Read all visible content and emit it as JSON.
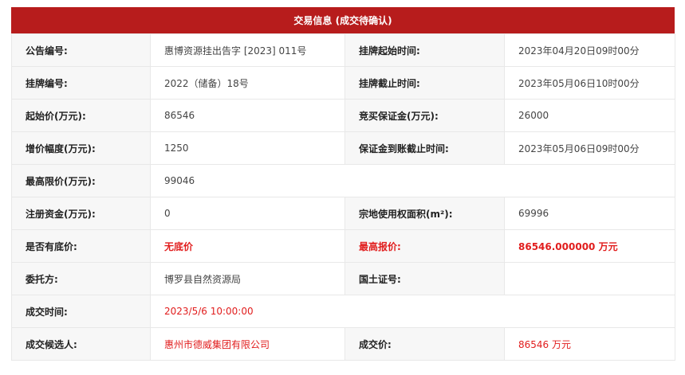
{
  "panel_title": "交易信息 (成交待确认)",
  "rows": [
    {
      "l1": "公告编号:",
      "v1": "惠博资源挂出告字 [2023] 011号",
      "l2": "挂牌起始时间:",
      "v2": "2023年04月20日09时00分"
    },
    {
      "l1": "挂牌编号:",
      "v1": "2022（储备）18号",
      "l2": "挂牌截止时间:",
      "v2": "2023年05月06日10时00分"
    },
    {
      "l1": "起始价(万元):",
      "v1": "86546",
      "l2": "竞买保证金(万元):",
      "v2": "26000"
    },
    {
      "l1": "增价幅度(万元):",
      "v1": "1250",
      "l2": "保证金到账截止时间:",
      "v2": "2023年05月06日09时00分"
    },
    {
      "l1": "最高限价(万元):",
      "v1": "99046"
    },
    {
      "l1": "注册资金(万元):",
      "v1": "0",
      "l2": "宗地使用权面积(m²):",
      "v2": "69996"
    },
    {
      "l1": "是否有底价:",
      "v1": "无底价",
      "l2": "最高报价:",
      "v2": "86546.000000 万元"
    },
    {
      "l1": "委托方:",
      "v1": "博罗县自然资源局",
      "l2": "国土证号:",
      "v2": ""
    },
    {
      "l1": "成交时间:",
      "v1": "2023/5/6 10:00:00"
    },
    {
      "l1": "成交候选人:",
      "v1": "惠州市德威集团有限公司",
      "l2": "成交价:",
      "v2": "86546 万元"
    }
  ],
  "colors": {
    "header_bg": "#b71c1c",
    "highlight": "#e11d1d"
  }
}
